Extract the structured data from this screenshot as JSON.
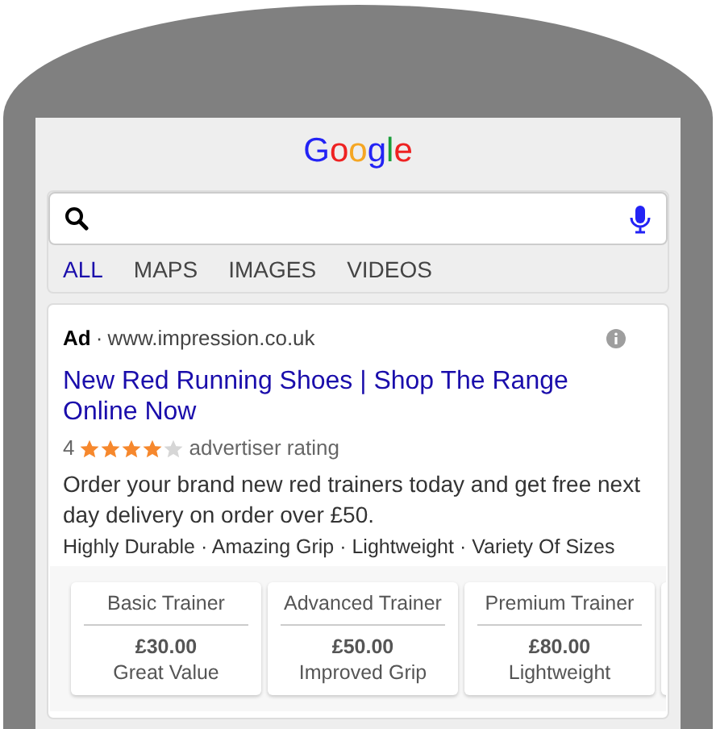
{
  "logo": "Google",
  "tabs": [
    {
      "label": "ALL",
      "selected": true
    },
    {
      "label": "MAPS",
      "selected": false
    },
    {
      "label": "IMAGES",
      "selected": false
    },
    {
      "label": "VIDEOS",
      "selected": false
    }
  ],
  "ad": {
    "badge": "Ad",
    "separator": "·",
    "url": "www.impression.co.uk",
    "title": "New Red Running Shoes | Shop The Range Online Now",
    "rating": "4",
    "stars": 4,
    "rating_label": "advertiser rating",
    "description": "Order your brand new red trainers today and get free next day delivery on order over £50.",
    "highlights": "Highly Durable · Amazing Grip · Lightweight · Variety Of Sizes",
    "sitelinks": [
      {
        "title": "Basic Trainer",
        "price": "£30.00",
        "note": "Great Value"
      },
      {
        "title": "Advanced Trainer",
        "price": "£50.00",
        "note": "Improved Grip"
      },
      {
        "title": "Premium Trainer",
        "price": "£80.00",
        "note": "Lightweight"
      }
    ]
  }
}
